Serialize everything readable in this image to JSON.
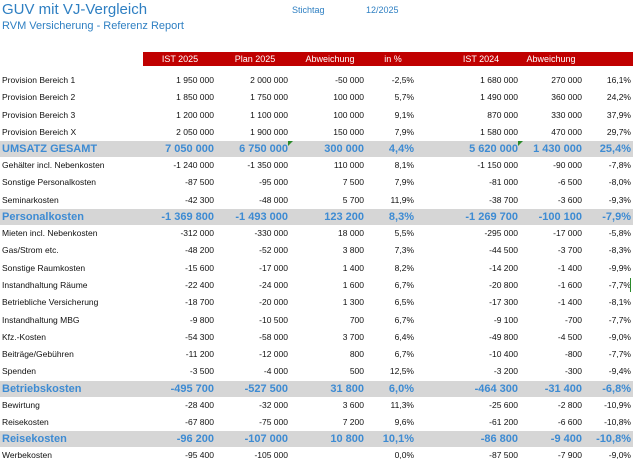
{
  "report": {
    "title": "GUV mit VJ-Vergleich",
    "subtitle": "RVM Versicherung - Referenz Report",
    "stichtag_label": "Stichtag",
    "stichtag_value": "12/2025"
  },
  "columns": [
    "IST 2025",
    "Plan 2025",
    "Abweichung",
    "in %",
    "IST 2024",
    "Abweichung",
    ""
  ],
  "rows": [
    {
      "type": "item",
      "label": "Provision Bereich 1",
      "v": [
        "1 950 000",
        "2 000 000",
        "-50 000",
        "-2,5%",
        "1 680 000",
        "270 000",
        "16,1%"
      ]
    },
    {
      "type": "item",
      "label": "Provision Bereich 2",
      "v": [
        "1 850 000",
        "1 750 000",
        "100 000",
        "5,7%",
        "1 490 000",
        "360 000",
        "24,2%"
      ]
    },
    {
      "type": "item",
      "label": "Provision Bereich 3",
      "v": [
        "1 200 000",
        "1 100 000",
        "100 000",
        "9,1%",
        "870 000",
        "330 000",
        "37,9%"
      ]
    },
    {
      "type": "item",
      "label": "Provision Bereich X",
      "v": [
        "2 050 000",
        "1 900 000",
        "150 000",
        "7,9%",
        "1 580 000",
        "470 000",
        "29,7%"
      ]
    },
    {
      "type": "total",
      "label": "UMSATZ GESAMT",
      "v": [
        "7 050 000",
        "6 750 000",
        "300 000",
        "4,4%",
        "5 620 000",
        "1 430 000",
        "25,4%"
      ]
    },
    {
      "type": "item",
      "label": "Gehälter incl. Nebenkosten",
      "v": [
        "-1 240 000",
        "-1 350 000",
        "110 000",
        "8,1%",
        "-1 150 000",
        "-90 000",
        "-7,8%"
      ]
    },
    {
      "type": "item",
      "label": "Sonstige Personalkosten",
      "v": [
        "-87 500",
        "-95 000",
        "7 500",
        "7,9%",
        "-81 000",
        "-6 500",
        "-8,0%"
      ]
    },
    {
      "type": "item",
      "label": "Seminarkosten",
      "v": [
        "-42 300",
        "-48 000",
        "5 700",
        "11,9%",
        "-38 700",
        "-3 600",
        "-9,3%"
      ]
    },
    {
      "type": "total",
      "label": "Personalkosten",
      "v": [
        "-1 369 800",
        "-1 493 000",
        "123 200",
        "8,3%",
        "-1 269 700",
        "-100 100",
        "-7,9%"
      ]
    },
    {
      "type": "item",
      "label": "Mieten incl. Nebenkosten",
      "v": [
        "-312 000",
        "-330 000",
        "18 000",
        "5,5%",
        "-295 000",
        "-17 000",
        "-5,8%"
      ]
    },
    {
      "type": "item",
      "label": "Gas/Strom etc.",
      "v": [
        "-48 200",
        "-52 000",
        "3 800",
        "7,3%",
        "-44 500",
        "-3 700",
        "-8,3%"
      ]
    },
    {
      "type": "item",
      "label": "Sonstige Raumkosten",
      "v": [
        "-15 600",
        "-17 000",
        "1 400",
        "8,2%",
        "-14 200",
        "-1 400",
        "-9,9%"
      ]
    },
    {
      "type": "item",
      "label": "Instandhaltung Räume",
      "v": [
        "-22 400",
        "-24 000",
        "1 600",
        "6,7%",
        "-20 800",
        "-1 600",
        "-7,7%"
      ]
    },
    {
      "type": "item",
      "label": "Betriebliche Versicherung",
      "v": [
        "-18 700",
        "-20 000",
        "1 300",
        "6,5%",
        "-17 300",
        "-1 400",
        "-8,1%"
      ]
    },
    {
      "type": "item",
      "label": "Instandhaltung MBG",
      "v": [
        "-9 800",
        "-10 500",
        "700",
        "6,7%",
        "-9 100",
        "-700",
        "-7,7%"
      ]
    },
    {
      "type": "item",
      "label": "Kfz.-Kosten",
      "v": [
        "-54 300",
        "-58 000",
        "3 700",
        "6,4%",
        "-49 800",
        "-4 500",
        "-9,0%"
      ]
    },
    {
      "type": "item",
      "label": "Beiträge/Gebühren",
      "v": [
        "-11 200",
        "-12 000",
        "800",
        "6,7%",
        "-10 400",
        "-800",
        "-7,7%"
      ]
    },
    {
      "type": "item",
      "label": "Spenden",
      "v": [
        "-3 500",
        "-4 000",
        "500",
        "12,5%",
        "-3 200",
        "-300",
        "-9,4%"
      ]
    },
    {
      "type": "total",
      "label": "Betriebskosten",
      "v": [
        "-495 700",
        "-527 500",
        "31 800",
        "6,0%",
        "-464 300",
        "-31 400",
        "-6,8%"
      ]
    },
    {
      "type": "item",
      "label": "Bewirtung",
      "v": [
        "-28 400",
        "-32 000",
        "3 600",
        "11,3%",
        "-25 600",
        "-2 800",
        "-10,9%"
      ]
    },
    {
      "type": "item",
      "label": "Reisekosten",
      "v": [
        "-67 800",
        "-75 000",
        "7 200",
        "9,6%",
        "-61 200",
        "-6 600",
        "-10,8%"
      ]
    },
    {
      "type": "total",
      "label": "Reisekosten",
      "v": [
        "-96 200",
        "-107 000",
        "10 800",
        "10,1%",
        "-86 800",
        "-9 400",
        "-10,8%"
      ]
    },
    {
      "type": "item",
      "label": "Werbekosten",
      "v": [
        "-95 400",
        "-105 000",
        "",
        "0,0%",
        "-87 500",
        "-7 900",
        "-9,0%"
      ]
    }
  ]
}
